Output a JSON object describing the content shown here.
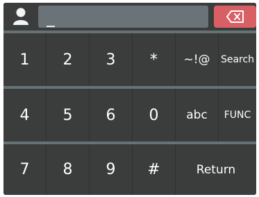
{
  "input": {
    "value": "",
    "cursor": "_"
  },
  "keys": {
    "row1": [
      "1",
      "2",
      "3",
      "*",
      "~!@",
      "Search"
    ],
    "row2": [
      "4",
      "5",
      "6",
      "0",
      "abc",
      "FUNC"
    ],
    "row3": [
      "7",
      "8",
      "9",
      "#",
      "Return"
    ]
  },
  "colors": {
    "panel": "#3a3d3c",
    "input": "#6a7378",
    "backspace": "#d85f64",
    "separator": "#677276"
  },
  "icons": {
    "user": "user-icon",
    "backspace": "backspace-icon"
  }
}
